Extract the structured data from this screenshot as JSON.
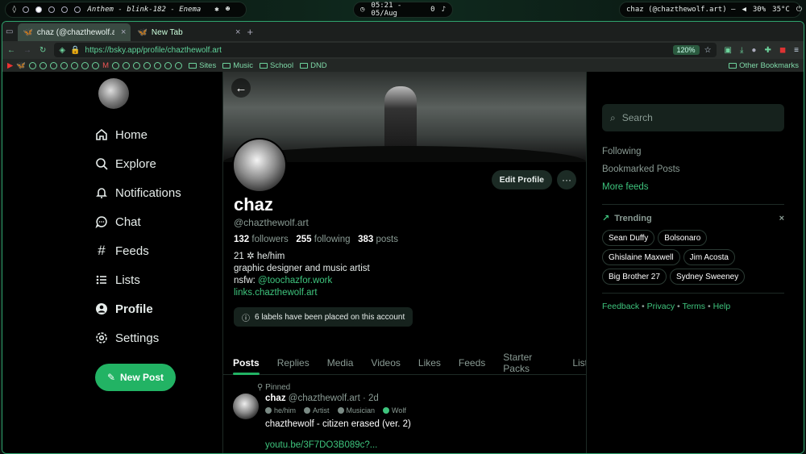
{
  "system": {
    "now_playing": "Anthem - blink-182 - Enema",
    "clock": "05:21 - 05/Aug",
    "notifications": "0",
    "window_title": "chaz (@chazthewolf.art) —",
    "volume": "30%",
    "temperature": "35°C"
  },
  "browser": {
    "tabs": [
      {
        "label": "chaz (@chazthewolf.art"
      },
      {
        "label": "New Tab"
      }
    ],
    "url": "https://bsky.app/profile/chazthewolf.art",
    "zoom": "120%",
    "bookmarks": [
      "Sites",
      "Music",
      "School",
      "DND"
    ],
    "other_bookmarks": "Other Bookmarks"
  },
  "leftnav": {
    "items": [
      {
        "label": "Home"
      },
      {
        "label": "Explore"
      },
      {
        "label": "Notifications"
      },
      {
        "label": "Chat"
      },
      {
        "label": "Feeds"
      },
      {
        "label": "Lists"
      },
      {
        "label": "Profile"
      },
      {
        "label": "Settings"
      }
    ],
    "new_post": "New Post"
  },
  "profile": {
    "name": "chaz",
    "handle": "@chazthewolf.art",
    "followers_count": "132",
    "followers_label": "followers",
    "following_count": "255",
    "following_label": "following",
    "posts_count": "383",
    "posts_label": "posts",
    "bio_line1": "21 ✲ he/him",
    "bio_line2": "graphic designer and music artist",
    "bio_nsfw_prefix": "nsfw: ",
    "bio_nsfw_link": "@toochazfor.work",
    "bio_link": "links.chazthewolf.art",
    "labels": "6 labels have been placed on this account",
    "edit": "Edit Profile",
    "more": "···",
    "tabs": [
      "Posts",
      "Replies",
      "Media",
      "Videos",
      "Likes",
      "Feeds",
      "Starter Packs",
      "List"
    ]
  },
  "post": {
    "pinned": "Pinned",
    "name": "chaz",
    "handle": "@chazthewolf.art · 2d",
    "badges": [
      "he/him",
      "Artist",
      "Musician",
      "Wolf"
    ],
    "text": "chazthewolf - citizen erased (ver. 2)",
    "link": "youtu.be/3F7DO3B089c?..."
  },
  "right": {
    "search_placeholder": "Search",
    "feeds": [
      "Following",
      "Bookmarked Posts"
    ],
    "more_feeds": "More feeds",
    "trending_title": "Trending",
    "trending": [
      "Sean Duffy",
      "Bolsonaro",
      "Ghislaine Maxwell",
      "Jim Acosta",
      "Big Brother 27",
      "Sydney Sweeney"
    ],
    "footer": [
      "Feedback",
      "Privacy",
      "Terms",
      "Help"
    ]
  },
  "colors": {
    "accent": "#22b364",
    "link": "#3ec47d",
    "background": "#000000"
  }
}
